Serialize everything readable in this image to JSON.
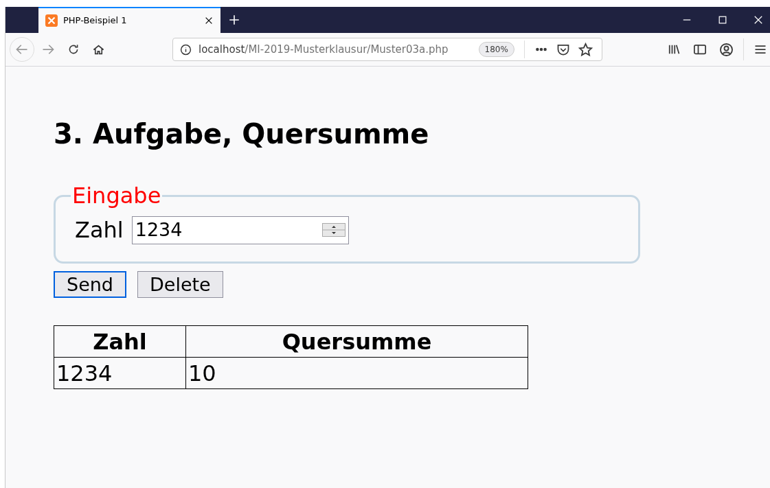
{
  "tab": {
    "title": "PHP-Beispiel 1",
    "selected": true
  },
  "address": {
    "host": "localhost",
    "path": "/MI-2019-Musterklausur/Muster03a.php",
    "zoom": "180%"
  },
  "page": {
    "heading": "3. Aufgabe, Quersumme",
    "fieldset": {
      "legend": "Eingabe",
      "label": "Zahl",
      "value": "1234"
    },
    "buttons": [
      {
        "label": "Send",
        "focused": true
      },
      {
        "label": "Delete",
        "focused": false
      }
    ],
    "table": {
      "columns": [
        "Zahl",
        "Quersumme"
      ],
      "rows": [
        [
          "1234",
          "10"
        ]
      ]
    }
  }
}
